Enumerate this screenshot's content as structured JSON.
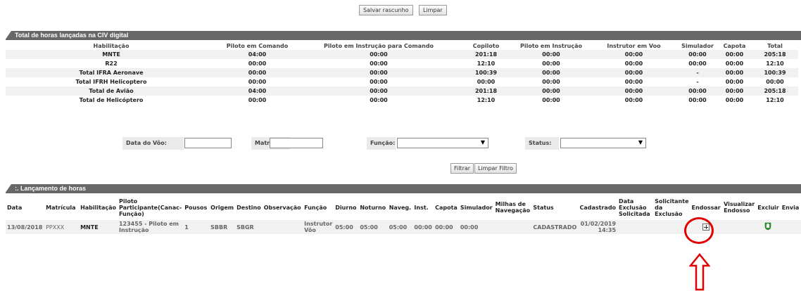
{
  "top_buttons": {
    "save": "Salvar rascunho",
    "clear": "Limpar"
  },
  "summary": {
    "title": "Total de horas lançadas na CIV digital",
    "headers": [
      "Habilitação",
      "Piloto em Comando",
      "Piloto em Instrução para Comando",
      "Copiloto",
      "Piloto em Instrução",
      "Instrutor em Voo",
      "Simulador",
      "Capota",
      "Total"
    ],
    "rows": [
      [
        "MNTE",
        "04:00",
        "00:00",
        "201:18",
        "00:00",
        "00:00",
        "00:00",
        "00:00",
        "205:18"
      ],
      [
        "R22",
        "00:00",
        "00:00",
        "12:10",
        "00:00",
        "00:00",
        "00:00",
        "00:00",
        "12:10"
      ],
      [
        "Total IFRA Aeronave",
        "00:00",
        "00:00",
        "100:39",
        "00:00",
        "00:00",
        "-",
        "00:00",
        "100:39"
      ],
      [
        "Total IFRH Helicoptero",
        "00:00",
        "00:00",
        "00:00",
        "00:00",
        "00:00",
        "-",
        "00:00",
        "00:00"
      ],
      [
        "Total de Avião",
        "04:00",
        "00:00",
        "201:18",
        "00:00",
        "00:00",
        "00:00",
        "00:00",
        "205:18"
      ],
      [
        "Total de Helicóptero",
        "00:00",
        "00:00",
        "12:10",
        "00:00",
        "00:00",
        "00:00",
        "00:00",
        "12:10"
      ]
    ]
  },
  "filters": {
    "date_label": "Data do Vôo:",
    "date_value": "",
    "plate_label": "Matrícula:",
    "plate_value": "",
    "function_label": "Função:",
    "function_value": "",
    "status_label": "Status:",
    "status_value": "",
    "filter_button": "Filtrar",
    "clear_filter_button": "Limpar Filtro"
  },
  "entries": {
    "title": ":. Lançamento de horas",
    "headers": [
      "Data",
      "Matrícula",
      "Habilitação",
      "Piloto Participante(Canac-Função)",
      "Pousos",
      "Origem",
      "Destino",
      "Observação",
      "Função",
      "Diurno",
      "Noturno",
      "Naveg.",
      "Inst.",
      "Capota",
      "Simulador",
      "Milhas de Navegação",
      "Status",
      "Cadastrado",
      "Data Exclusão Solicitada",
      "Solicitante da Exclusão",
      "Endossar",
      "Visualizar Endosso",
      "Excluir",
      "Envia"
    ],
    "rows": [
      {
        "data": "13/08/2018",
        "matricula": "PPXXX",
        "habilitacao": "MNTE",
        "piloto": "123455 - Piloto em Instrução",
        "pousos": "1",
        "origem": "SBBR",
        "destino": "SBGR",
        "observacao": "",
        "funcao": "Instrutor Vôo",
        "diurno": "05:00",
        "noturno": "05:00",
        "naveg": "05:00",
        "inst": "00:00",
        "capota": "00:00",
        "simulador": "00:00",
        "milhas": "",
        "status": "CADASTRADO",
        "cadastrado": "01/02/2019 14:35",
        "data_exclusao": "",
        "solicitante": "",
        "excluir_icon": "trash-shield-icon"
      }
    ]
  },
  "annotation": {
    "color": "#e00000"
  }
}
